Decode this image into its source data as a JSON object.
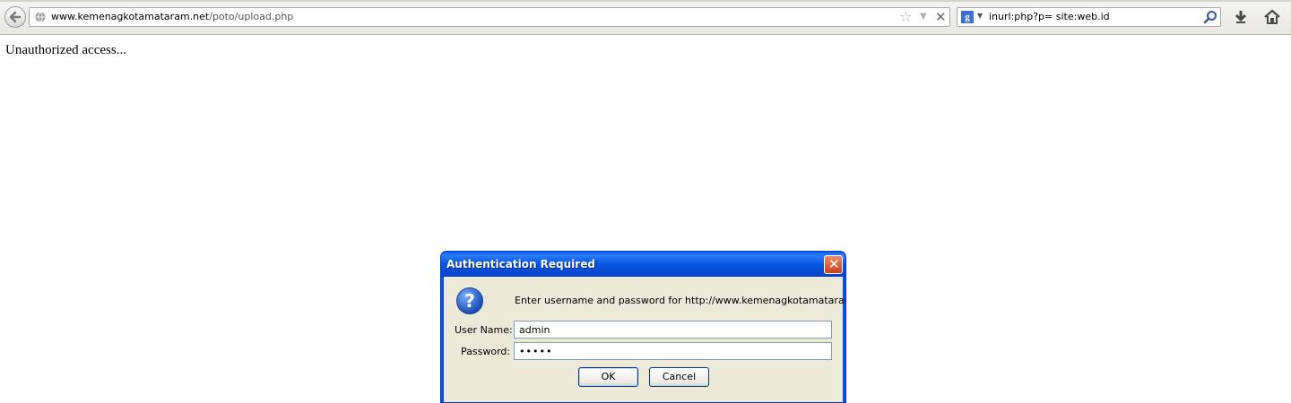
{
  "browser": {
    "url": {
      "domain": "www.kemenagkotamataram.net",
      "path": "/poto/upload.php"
    },
    "search": {
      "query": "inurl:php?p= site:web.id",
      "engine_letter": "g"
    }
  },
  "page": {
    "body_text": "Unauthorized access..."
  },
  "dialog": {
    "title": "Authentication Required",
    "close_glyph": "✕",
    "message": "Enter username and password for http://www.kemenagkotamataram.net",
    "username_label": "User Name:",
    "username_value": "admin",
    "password_label": "Password:",
    "password_value": "•••••",
    "ok_label": "OK",
    "cancel_label": "Cancel",
    "question_glyph": "?"
  },
  "colors": {
    "titlebar": "#0a52de",
    "dialog_body": "#ece9d8",
    "close_button": "#c8421e"
  }
}
